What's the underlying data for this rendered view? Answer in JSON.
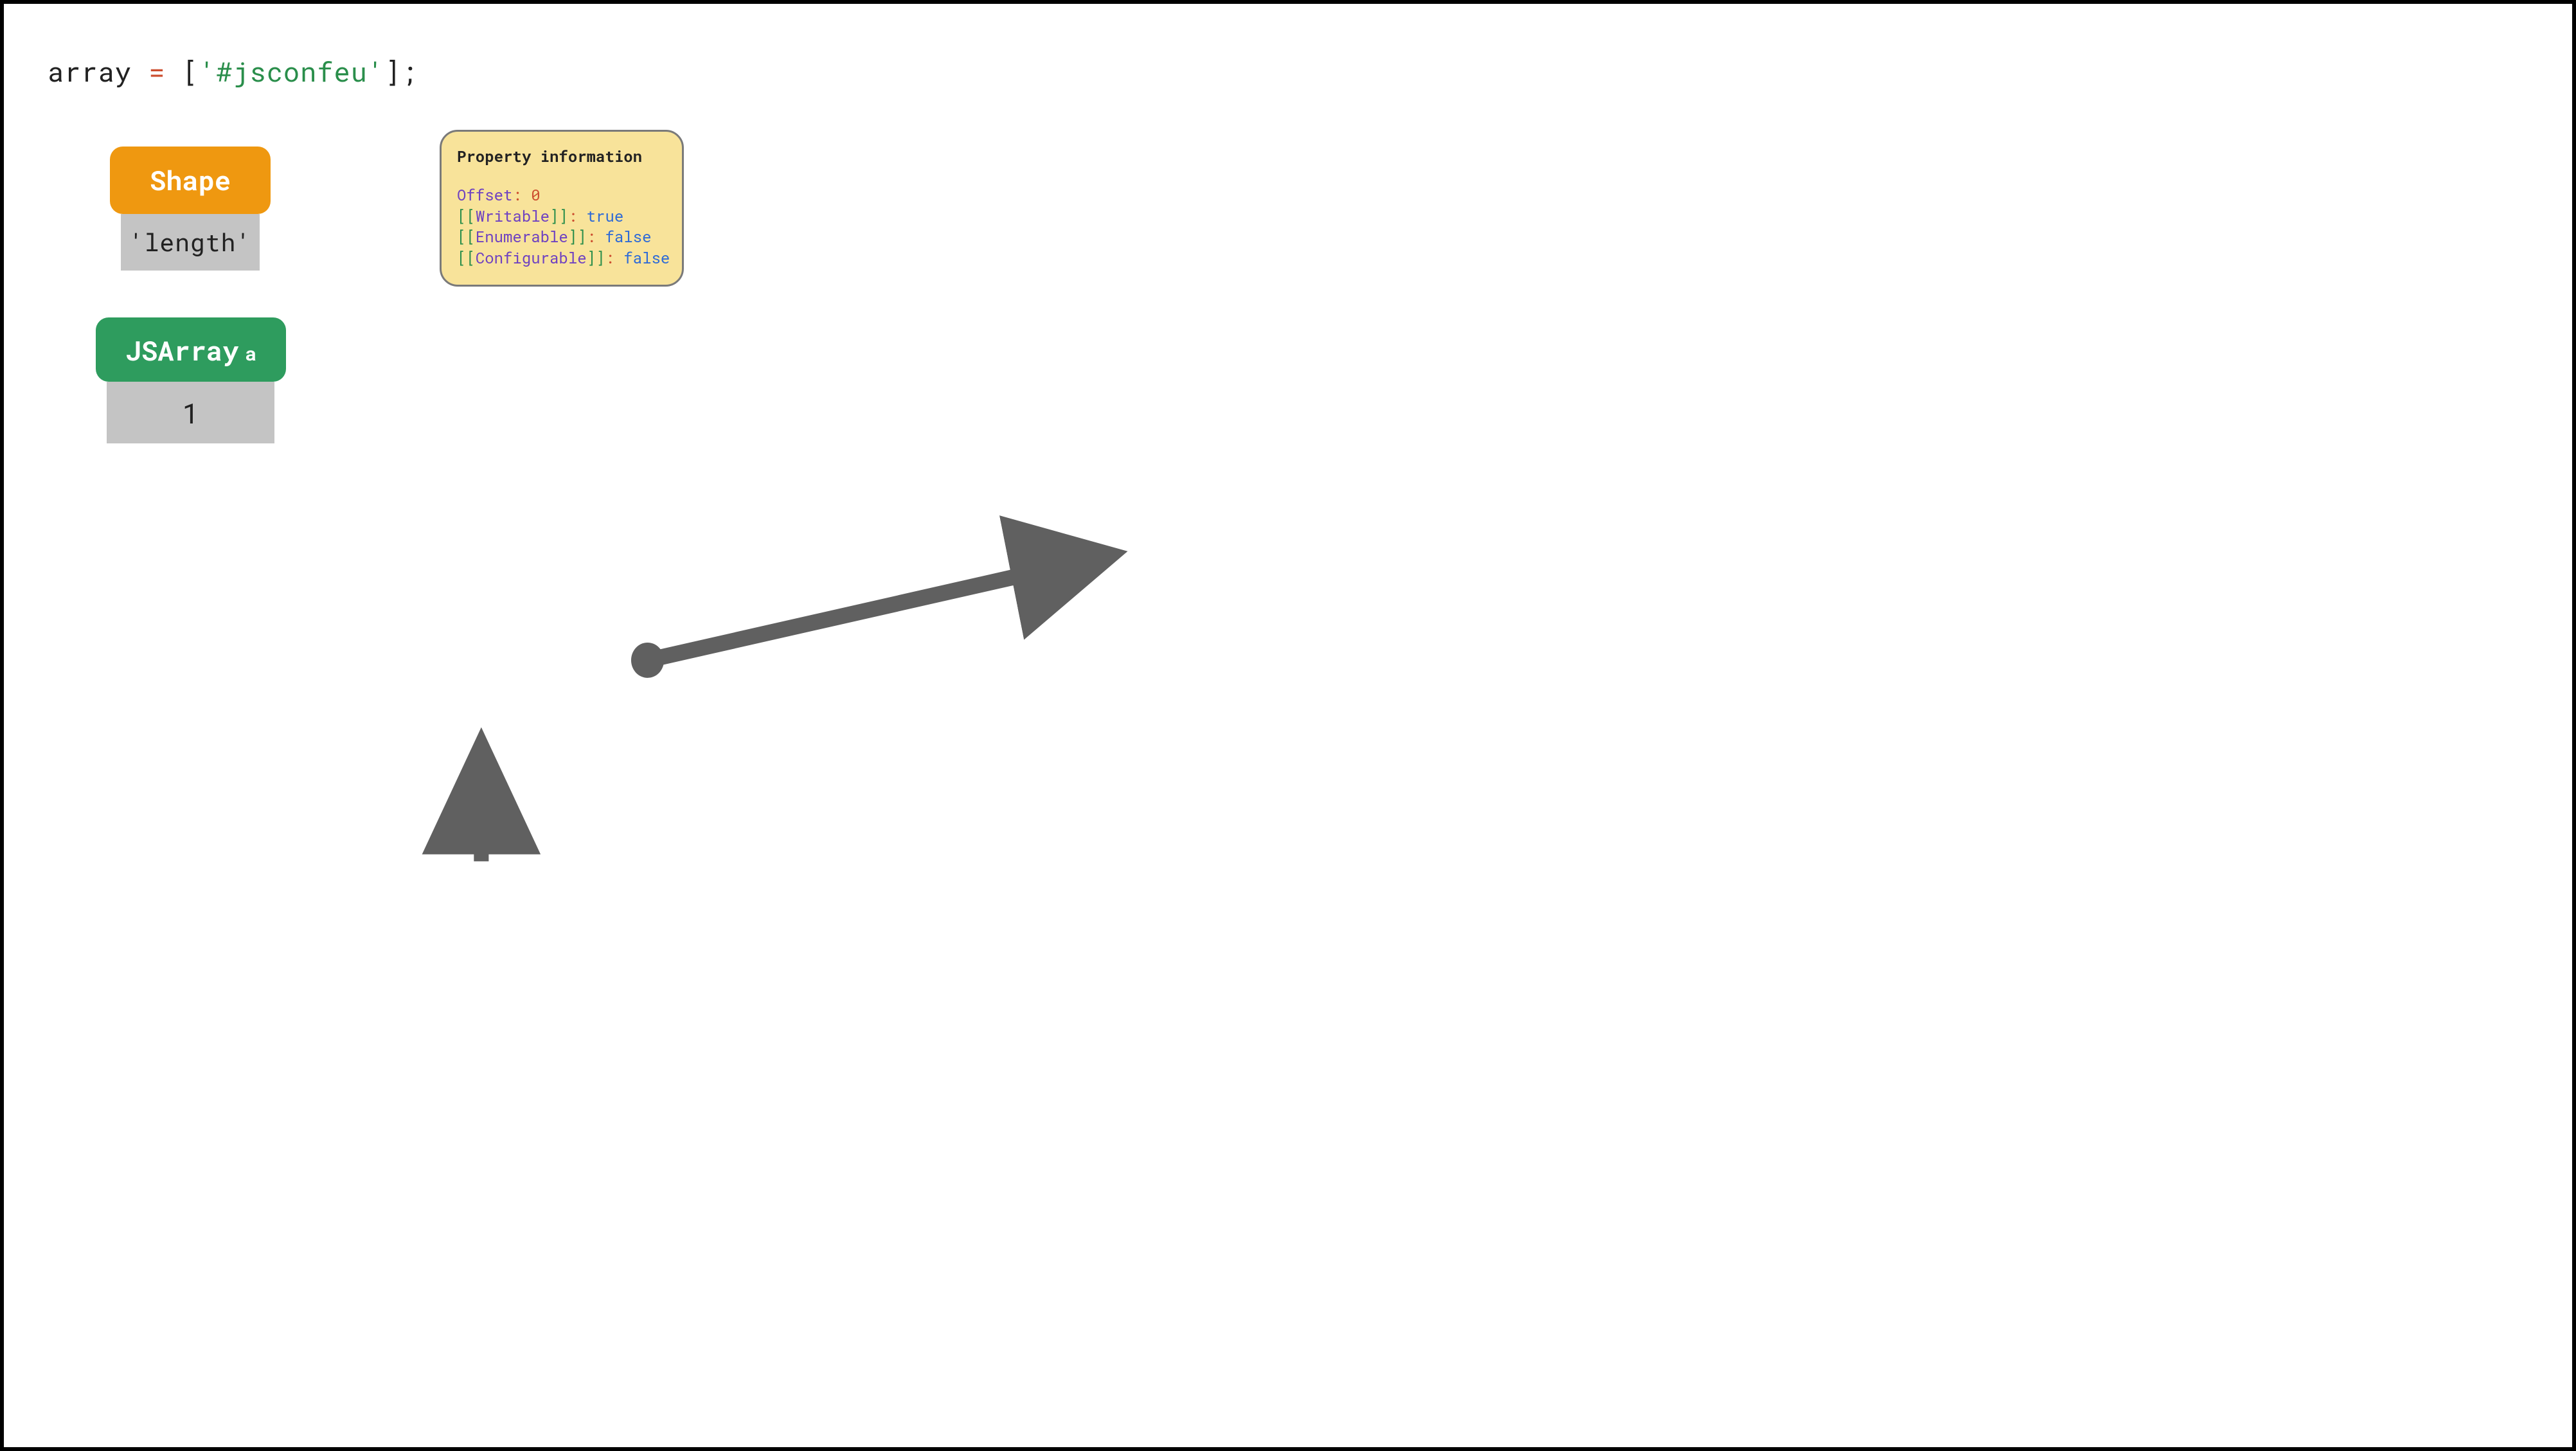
{
  "code": {
    "identifier": "array",
    "assign_op": " = ",
    "lbracket": "[",
    "string": "'#jsconfeu'",
    "rbracket": "];"
  },
  "shape": {
    "header": "Shape",
    "property_name": "'length'"
  },
  "jsarray": {
    "header_main": "JSArray",
    "header_sub": "a",
    "length_value": "1"
  },
  "property_info": {
    "heading": "Property information",
    "offset_key": "Offset",
    "offset_value": "0",
    "writable_key": "Writable",
    "writable_value": "true",
    "enumerable_key": "Enumerable",
    "enumerable_value": "false",
    "configurable_key": "Configurable",
    "configurable_value": "false"
  }
}
